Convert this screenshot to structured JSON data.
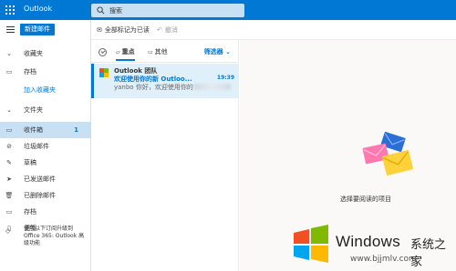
{
  "app": {
    "title": "Outlook"
  },
  "search": {
    "placeholder": "搜索"
  },
  "sidebar": {
    "new_mail": "新建邮件",
    "favorites": "收藏夹",
    "fav_archive": "存档",
    "add_favorite": "加入收藏夹",
    "folders": "文件夹",
    "items": [
      {
        "label": "收件箱",
        "count": "1",
        "icon": "inbox-icon"
      },
      {
        "label": "垃圾邮件",
        "count": "",
        "icon": "junk-icon"
      },
      {
        "label": "草稿",
        "count": "",
        "icon": "drafts-icon"
      },
      {
        "label": "已发送邮件",
        "count": "",
        "icon": "send-icon"
      },
      {
        "label": "已删除邮件",
        "count": "",
        "icon": "trash-icon"
      },
      {
        "label": "存档",
        "count": "",
        "icon": "archive-icon"
      },
      {
        "label": "便笺",
        "count": "",
        "icon": "notes-icon"
      }
    ],
    "promo": "使用以下订阅升级到 Office 365: Outlook 高级功能"
  },
  "commands": {
    "mark_all_read": "全部标记为已读",
    "undo": "撤消"
  },
  "list": {
    "tab_focused": "重点",
    "tab_other": "其他",
    "filter": "筛选器",
    "messages": [
      {
        "sender": "Outlook 团队",
        "subject": "欢迎使用你的新 Outloo...",
        "time": "19:39",
        "preview": "yanbo 你好，欢迎使用你的"
      }
    ]
  },
  "reading": {
    "empty": "选择要阅读的项目"
  },
  "watermark": {
    "title": "Windows",
    "cn": "系统之家",
    "url": "www.bjjmlv.com"
  },
  "colors": {
    "accent": "#0078d4",
    "selected": "#c7e0f4"
  }
}
